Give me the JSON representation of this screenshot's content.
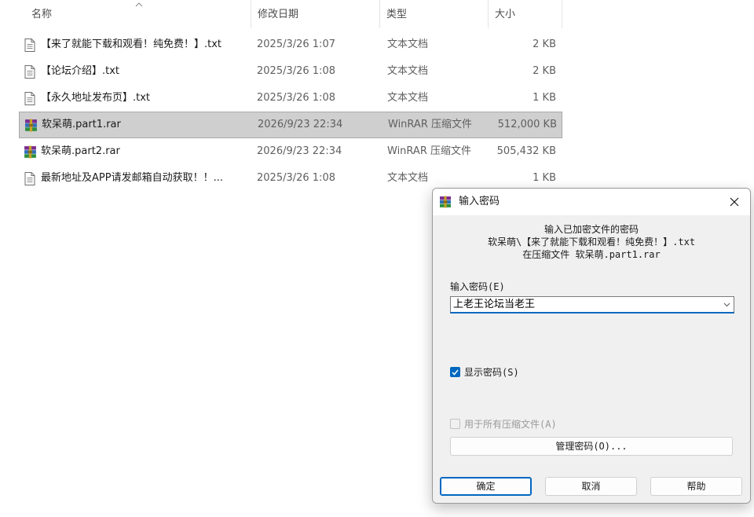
{
  "explorer": {
    "columns": {
      "name": "名称",
      "date": "修改日期",
      "type": "类型",
      "size": "大小"
    },
    "files": [
      {
        "name": "【来了就能下载和观看！纯免费！】.txt",
        "date": "2025/3/26 1:07",
        "type": "文本文档",
        "size": "2 KB",
        "icon": "text-file-icon",
        "selected": false
      },
      {
        "name": "【论坛介绍】.txt",
        "date": "2025/3/26 1:08",
        "type": "文本文档",
        "size": "2 KB",
        "icon": "text-file-icon",
        "selected": false
      },
      {
        "name": "【永久地址发布页】.txt",
        "date": "2025/3/26 1:08",
        "type": "文本文档",
        "size": "1 KB",
        "icon": "text-file-icon",
        "selected": false
      },
      {
        "name": "软呆萌.part1.rar",
        "date": "2026/9/23 22:34",
        "type": "WinRAR 压缩文件",
        "size": "512,000 KB",
        "icon": "winrar-archive-icon",
        "selected": true
      },
      {
        "name": "软呆萌.part2.rar",
        "date": "2026/9/23 22:34",
        "type": "WinRAR 压缩文件",
        "size": "505,432 KB",
        "icon": "winrar-archive-icon",
        "selected": false
      },
      {
        "name": "最新地址及APP请发邮箱自动获取！！...",
        "date": "2025/3/26 1:08",
        "type": "文本文档",
        "size": "1 KB",
        "icon": "text-file-icon",
        "selected": false
      }
    ]
  },
  "dialog": {
    "title": "输入密码",
    "info_line1": "输入已加密文件的密码",
    "info_line2": "软呆萌\\【来了就能下载和观看！纯免费！】.txt",
    "info_line3": "在压缩文件 软呆萌.part1.rar",
    "password_label": "输入密码(E)",
    "password_value": "上老王论坛当老王",
    "show_password_label": "显示密码(S)",
    "show_password_checked": true,
    "use_for_all_label": "用于所有压缩文件(A)",
    "use_for_all_checked": false,
    "manage_button": "管理密码(O)...",
    "ok_button": "确定",
    "cancel_button": "取消",
    "help_button": "帮助"
  },
  "colors": {
    "accent": "#0067c0",
    "selection": "#cfcfcf"
  }
}
